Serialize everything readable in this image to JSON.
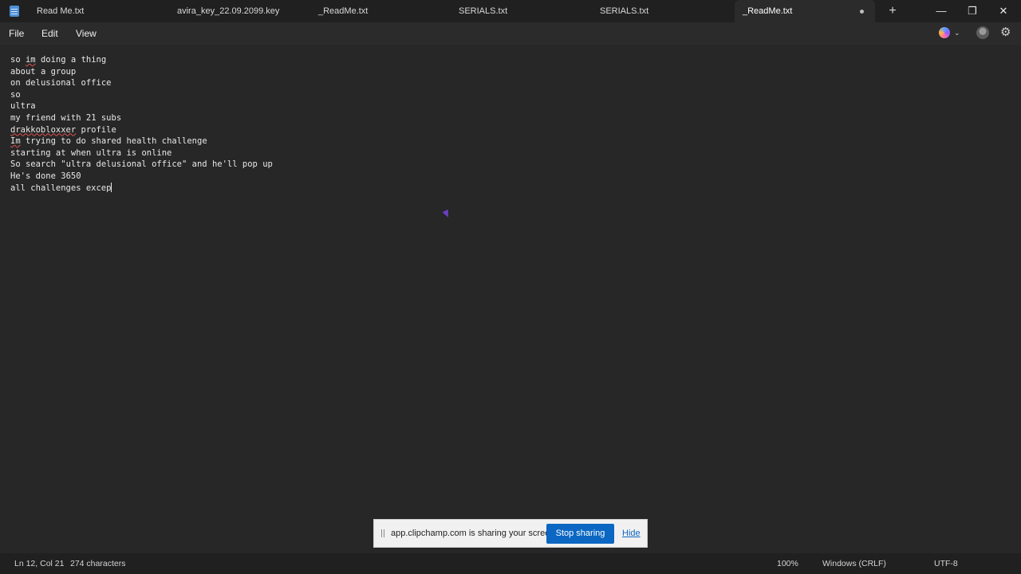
{
  "window": {
    "tabs": [
      {
        "label": "Read Me.txt"
      },
      {
        "label": "avira_key_22.09.2099.key"
      },
      {
        "label": "_ReadMe.txt"
      },
      {
        "label": "SERIALS.txt"
      },
      {
        "label": "SERIALS.txt"
      },
      {
        "label": "_ReadMe.txt",
        "active": true,
        "unsaved": true
      }
    ],
    "new_tab_glyph": "+",
    "controls": {
      "minimize": "—",
      "maximize": "❐",
      "close": "✕"
    }
  },
  "menu": {
    "items": [
      "File",
      "Edit",
      "View"
    ]
  },
  "icons": {
    "app": "notepad-icon",
    "copilot": "copilot-icon",
    "profile": "avatar",
    "settings": "gear-icon",
    "settings_glyph": "⚙",
    "chevron_glyph": "⌄"
  },
  "editor": {
    "lines": [
      "so im doing a thing",
      "about a group",
      "on delusional office",
      "so",
      "ultra",
      "my friend with 21 subs",
      "drakkobloxxer profile",
      "Im trying to do shared health challenge",
      "starting at when ultra is online",
      "So search \"ultra delusional office\" and he'll pop up",
      "He's done 3650",
      "all challenges excep"
    ]
  },
  "share_bar": {
    "message": "app.clipchamp.com is sharing your screen.",
    "stop_label": "Stop sharing",
    "hide_label": "Hide"
  },
  "status": {
    "position": "Ln 12, Col 21",
    "characters": "274 characters",
    "zoom": "100%",
    "line_ending": "Windows (CRLF)",
    "encoding": "UTF-8"
  },
  "colors": {
    "background": "#272727",
    "titlebar": "#202020",
    "accent_button": "#0b67c2",
    "spellcheck": "#e05252"
  }
}
